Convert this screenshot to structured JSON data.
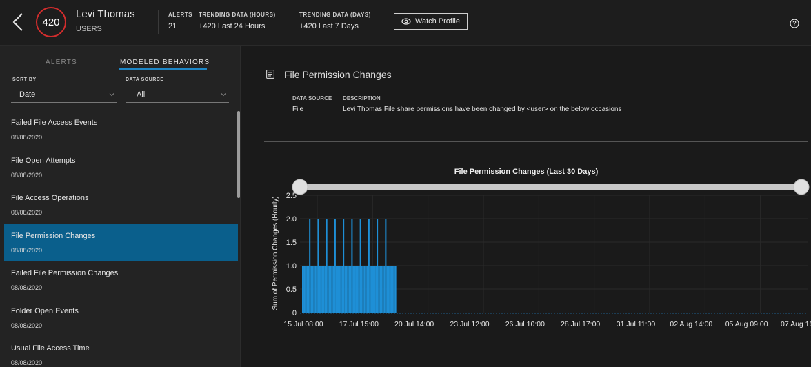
{
  "header": {
    "score": "420",
    "user_name": "Levi Thomas",
    "user_type": "USERS",
    "alerts_label": "ALERTS",
    "alerts_value": "21",
    "trend_hours_label": "TRENDING DATA (HOURS)",
    "trend_hours_value": "+420  Last 24 Hours",
    "trend_days_label": "TRENDING DATA (DAYS)",
    "trend_days_value": "+420  Last 7 Days",
    "watch_label": "Watch Profile",
    "icons": [
      "chevron-left-icon",
      "eye-icon",
      "help-icon"
    ]
  },
  "sidebar": {
    "tabs": [
      {
        "label": "ALERTS",
        "active": false
      },
      {
        "label": "MODELED BEHAVIORS",
        "active": true
      }
    ],
    "sort_by_label": "SORT BY",
    "sort_by_value": "Date",
    "data_source_label": "DATA SOURCE",
    "data_source_value": "All",
    "items": [
      {
        "title": "Failed File Access Events",
        "date": "08/08/2020"
      },
      {
        "title": "File Open Attempts",
        "date": "08/08/2020"
      },
      {
        "title": "File Access Operations",
        "date": "08/08/2020"
      },
      {
        "title": "File Permission Changes",
        "date": "08/08/2020",
        "active": true
      },
      {
        "title": "Failed File Permission Changes",
        "date": "08/08/2020"
      },
      {
        "title": "Folder Open Events",
        "date": "08/08/2020"
      },
      {
        "title": "Usual File Access Time",
        "date": "08/08/2020"
      }
    ]
  },
  "main": {
    "title": "File Permission Changes",
    "data_source_label": "DATA SOURCE",
    "data_source_value": "File",
    "description_label": "DESCRIPTION",
    "description_value": "Levi Thomas File share permissions have been changed by <user> on the below occasions"
  },
  "colors": {
    "accent": "#1e87c7",
    "active_row": "#0a5f8c",
    "score_ring": "#d22d2d",
    "bar": "#1e8fd6"
  },
  "chart_data": {
    "type": "bar",
    "title": "File Permission Changes (Last 30 Days)",
    "ylabel": "Sum of Permission Changes (Hourly)",
    "xlabel": "",
    "ylim": [
      0,
      2.5
    ],
    "yticks": [
      "0",
      "0.5",
      "1.0",
      "1.5",
      "2.0",
      "2.5"
    ],
    "xticks": [
      "15 Jul 08:00",
      "17 Jul 15:00",
      "20 Jul 14:00",
      "23 Jul 12:00",
      "26 Jul 10:00",
      "28 Jul 17:00",
      "31 Jul 11:00",
      "02 Aug 14:00",
      "05 Aug 09:00",
      "07 Aug 16:00"
    ],
    "grid": true,
    "range_slider": [
      0,
      1
    ],
    "values": [
      1,
      1,
      1,
      1,
      1,
      2,
      1,
      1,
      1,
      1,
      1,
      2,
      1,
      1,
      1,
      1,
      1,
      2,
      1,
      1,
      1,
      1,
      1,
      2,
      1,
      1,
      1,
      1,
      1,
      2,
      1,
      1,
      1,
      1,
      1,
      2,
      1,
      1,
      1,
      1,
      1,
      2,
      1,
      1,
      1,
      1,
      1,
      2,
      1,
      1,
      1,
      1,
      1,
      2,
      1,
      1,
      1,
      1,
      1,
      2,
      1,
      1,
      1,
      1,
      1,
      1,
      1
    ]
  }
}
